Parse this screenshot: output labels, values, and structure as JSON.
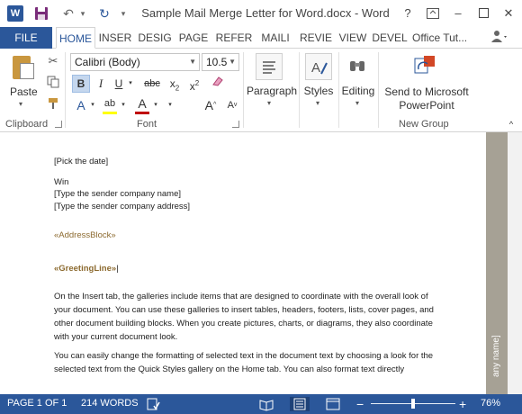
{
  "titlebar": {
    "app_icon_letter": "W",
    "title": "Sample Mail Merge Letter for Word.docx - Word",
    "help": "?",
    "minimize": "–",
    "close": "✕"
  },
  "tabs": {
    "file": "FILE",
    "items": [
      "HOME",
      "INSER",
      "DESIG",
      "PAGE",
      "REFER",
      "MAILI",
      "REVIE",
      "VIEW",
      "DEVEL"
    ],
    "active": "HOME",
    "account": "Office Tut..."
  },
  "ribbon": {
    "clipboard": {
      "paste": "Paste",
      "label": "Clipboard"
    },
    "font": {
      "font_name": "Calibri (Body)",
      "font_size": "10.5",
      "label": "Font",
      "bold": "B",
      "italic": "I",
      "underline": "U",
      "strike": "abc",
      "subscript": "x",
      "subscript_digit": "2",
      "superscript": "x",
      "superscript_digit": "2",
      "grow": "A",
      "shrink": "A",
      "effects": "A",
      "font_color": "A",
      "highlight": "ab",
      "highlight_color": "#ffff00",
      "font_color_value": "#c00000"
    },
    "paragraph": {
      "label": "Paragraph"
    },
    "styles": {
      "label": "Styles"
    },
    "editing": {
      "label": "Editing"
    },
    "new_group": {
      "button_line1": "Send to Microsoft",
      "button_line2": "PowerPoint",
      "label": "New Group"
    }
  },
  "document": {
    "date": "[Pick the date]",
    "sender_name": "Win",
    "sender_company": "[Type the sender company name]",
    "sender_address": "[Type the sender company address]",
    "address_block": "«AddressBlock»",
    "greeting_line": "«GreetingLine»",
    "para1": "On the Insert tab, the galleries include items that are designed to coordinate with the overall look of your document. You can use these galleries to insert tables, headers, footers, lists, cover pages, and other document building blocks. When you create pictures, charts, or diagrams, they also coordinate with your current document look.",
    "para2": "You can easily change the formatting of selected text in the document text by choosing a look for the selected text from the Quick Styles gallery on the Home tab. You can also format text directly",
    "side_text": "any name]"
  },
  "status": {
    "page": "PAGE 1 OF 1",
    "words": "214 WORDS",
    "zoom_minus": "−",
    "zoom_plus": "+",
    "zoom": "76%",
    "zoom_fraction": 0.5
  },
  "colors": {
    "accent": "#2b579a",
    "merge_field": "#8c6a2f",
    "side_band": "#a6a195"
  }
}
